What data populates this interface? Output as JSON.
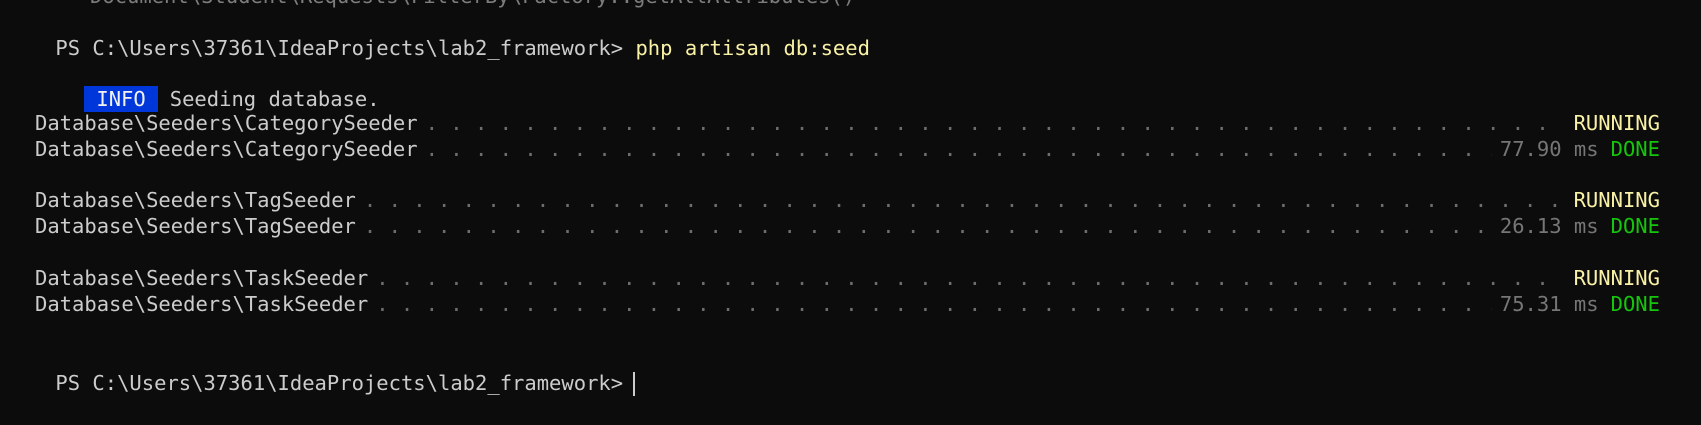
{
  "terminal": {
    "cut_off_line": "Document\\Student\\Requests\\FilterBy\\Factory::getAllAttributes()",
    "prompt1": "PS C:\\Users\\37361\\IdeaProjects\\lab2_framework>",
    "command": "php artisan db:seed",
    "info_badge": "INFO",
    "info_message": "Seeding database.",
    "rows": [
      {
        "seeder": "Database\\Seeders\\CategorySeeder",
        "timing": "",
        "status": "RUNNING"
      },
      {
        "seeder": "Database\\Seeders\\CategorySeeder",
        "timing": "77.90 ms",
        "status": "DONE"
      },
      {
        "seeder": "Database\\Seeders\\TagSeeder",
        "timing": "",
        "status": "RUNNING"
      },
      {
        "seeder": "Database\\Seeders\\TagSeeder",
        "timing": "26.13 ms",
        "status": "DONE"
      },
      {
        "seeder": "Database\\Seeders\\TaskSeeder",
        "timing": "",
        "status": "RUNNING"
      },
      {
        "seeder": "Database\\Seeders\\TaskSeeder",
        "timing": "75.31 ms",
        "status": "DONE"
      }
    ],
    "prompt2": "PS C:\\Users\\37361\\IdeaProjects\\lab2_framework>"
  },
  "colors": {
    "background": "#0c0c0c",
    "text": "#cccccc",
    "command": "#f9f1a5",
    "info_bg": "#0037da",
    "running": "#f9f1a5",
    "done": "#16c60c",
    "timing": "#767676"
  }
}
